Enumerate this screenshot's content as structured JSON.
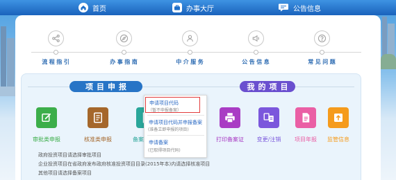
{
  "header": {
    "nav": [
      {
        "icon": "home-icon",
        "label": "首页"
      },
      {
        "icon": "briefcase-icon",
        "label": "办事大厅"
      },
      {
        "icon": "chat-icon",
        "label": "公告信息"
      }
    ]
  },
  "quick_links": [
    {
      "icon": "share-icon",
      "label": "流程指引"
    },
    {
      "icon": "compass-icon",
      "label": "办事指南"
    },
    {
      "icon": "support-icon",
      "label": "中介服务"
    },
    {
      "icon": "speaker-icon",
      "label": "公告信息"
    },
    {
      "icon": "question-icon",
      "label": "常见问题"
    }
  ],
  "project_declare": {
    "title": "项目申报",
    "items": [
      {
        "icon": "edit-icon",
        "label": "审批类申报",
        "color": "#3cae4a"
      },
      {
        "icon": "document-list-icon",
        "label": "核准类申报",
        "color": "#a5672b"
      },
      {
        "icon": "file-check-icon",
        "label": "备案类申报",
        "color": "#2aa69a"
      }
    ],
    "notes": [
      "政府投资项目请选择审批项目",
      "企业投资项目在省政府发布政府核准投资项目目录(2015年本)内请选择核准项目",
      "其他项目请选择备案项目"
    ]
  },
  "my_projects": {
    "title": "我的项目",
    "items": [
      {
        "icon": "printer-icon",
        "label": "打印备案证",
        "color": "#a93cc4"
      },
      {
        "icon": "swap-icon",
        "label": "变更/注销",
        "color": "#7b57dc"
      },
      {
        "icon": "report-icon",
        "label": "项目年报",
        "color": "#ea5fa5"
      },
      {
        "icon": "upload-icon",
        "label": "监管信息",
        "color": "#f59b1c"
      }
    ]
  },
  "filing_dropdown": {
    "items": [
      {
        "title": "申请项目代码",
        "subtitle": "（暂不申报备案）",
        "highlighted": true
      },
      {
        "title": "申请项目代码并申报备案",
        "subtitle": "(准备立即申报的项目)",
        "highlighted": false
      },
      {
        "title": "申请备案",
        "subtitle": "(已取得项目代码)",
        "highlighted": false
      }
    ]
  },
  "colors": {
    "declare_pill": "#2774c6",
    "my_pill": "#6a4fcf",
    "highlight_border": "#e23b3b",
    "header_blue": "#1f6fc9"
  }
}
